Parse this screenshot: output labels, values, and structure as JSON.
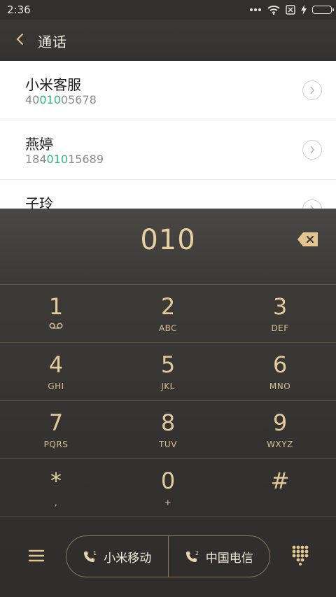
{
  "status_bar": {
    "time": "2:36",
    "battery_color": "#3fc34a"
  },
  "header": {
    "title": "通话"
  },
  "contacts": [
    {
      "name": "小米客服",
      "number_pre": "40",
      "number_match": "010",
      "number_post": "05678"
    },
    {
      "name": "燕婷",
      "number_pre": "184",
      "number_match": "010",
      "number_post": "15689"
    },
    {
      "name": "子玲",
      "number_pre": "",
      "number_match": "",
      "number_post": ""
    }
  ],
  "dialer": {
    "input": "010",
    "keys": [
      [
        {
          "digit": "1",
          "letters": ""
        },
        {
          "digit": "2",
          "letters": "ABC"
        },
        {
          "digit": "3",
          "letters": "DEF"
        }
      ],
      [
        {
          "digit": "4",
          "letters": "GHI"
        },
        {
          "digit": "5",
          "letters": "JKL"
        },
        {
          "digit": "6",
          "letters": "MNO"
        }
      ],
      [
        {
          "digit": "7",
          "letters": "PQRS"
        },
        {
          "digit": "8",
          "letters": "TUV"
        },
        {
          "digit": "9",
          "letters": "WXYZ"
        }
      ],
      [
        {
          "digit": "*",
          "letters": ","
        },
        {
          "digit": "0",
          "letters": "+"
        },
        {
          "digit": "#",
          "letters": ""
        }
      ]
    ],
    "sim1_label": "小米移动",
    "sim2_label": "中国电信"
  },
  "colors": {
    "highlight": "#2db67a",
    "gold": "#e4c99a"
  }
}
